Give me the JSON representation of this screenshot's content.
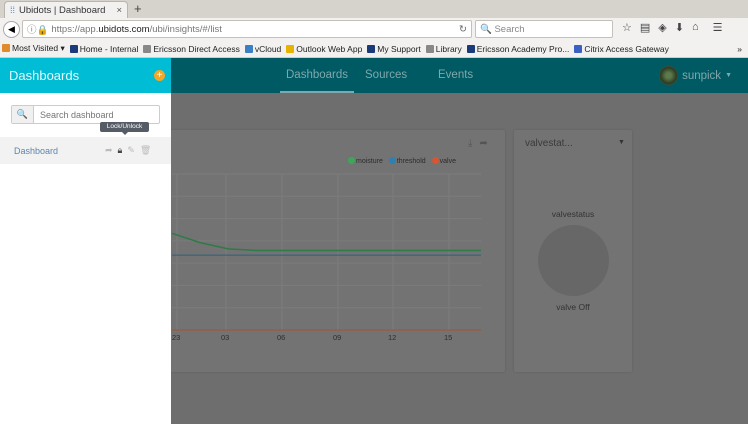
{
  "browser": {
    "tab_title": "Ubidots | Dashboard",
    "url_prefix": "https://app.",
    "url_domain": "ubidots.com",
    "url_path": "/ubi/insights/#/list",
    "search_placeholder": "Search",
    "bookmarks": [
      {
        "label": "Most Visited ▾",
        "color": "#e08a2e"
      },
      {
        "label": "Home - Internal",
        "color": "#1b3a7a"
      },
      {
        "label": "Ericsson Direct Access",
        "color": "#888888"
      },
      {
        "label": "vCloud",
        "color": "#3b7fc4"
      },
      {
        "label": "Outlook Web App",
        "color": "#e8b300"
      },
      {
        "label": "My Support",
        "color": "#1b3a7a"
      },
      {
        "label": "Library",
        "color": "#888888"
      },
      {
        "label": "Ericsson Academy Pro...",
        "color": "#1b3a7a"
      },
      {
        "label": "Citrix Access Gateway",
        "color": "#3b5fc4"
      }
    ],
    "overflow": "»"
  },
  "topnav": {
    "items": [
      "Dashboards",
      "Sources",
      "Events"
    ],
    "user": "sunpick"
  },
  "sidebar": {
    "title": "Dashboards",
    "add": "+",
    "search_placeholder": "Search dashboard",
    "tooltip": "Lock/Unlock",
    "dashboards": [
      {
        "label": "Dashboard"
      }
    ]
  },
  "chart_data": {
    "type": "line",
    "x_ticks": [
      "23",
      "03",
      "06",
      "09",
      "12",
      "15"
    ],
    "legend": [
      {
        "name": "moisture",
        "color": "#3aa857"
      },
      {
        "name": "threshold",
        "color": "#2f7fb0"
      },
      {
        "name": "valve",
        "color": "#d9552f"
      }
    ],
    "series": [
      {
        "name": "moisture",
        "values": [
          62,
          56,
          52,
          51,
          51,
          51,
          51,
          51,
          51,
          51,
          51,
          51
        ]
      },
      {
        "name": "threshold",
        "values": [
          48,
          48,
          48,
          48,
          48,
          48,
          48,
          48,
          48,
          48,
          48,
          48
        ]
      },
      {
        "name": "valve",
        "values": [
          0,
          0,
          0,
          0,
          0,
          0,
          0,
          0,
          0,
          0,
          0,
          0
        ]
      }
    ],
    "ylim": [
      0,
      100
    ]
  },
  "valve_widget": {
    "title": "valvestat...",
    "variable": "valvestatus",
    "state": "valve Off"
  }
}
